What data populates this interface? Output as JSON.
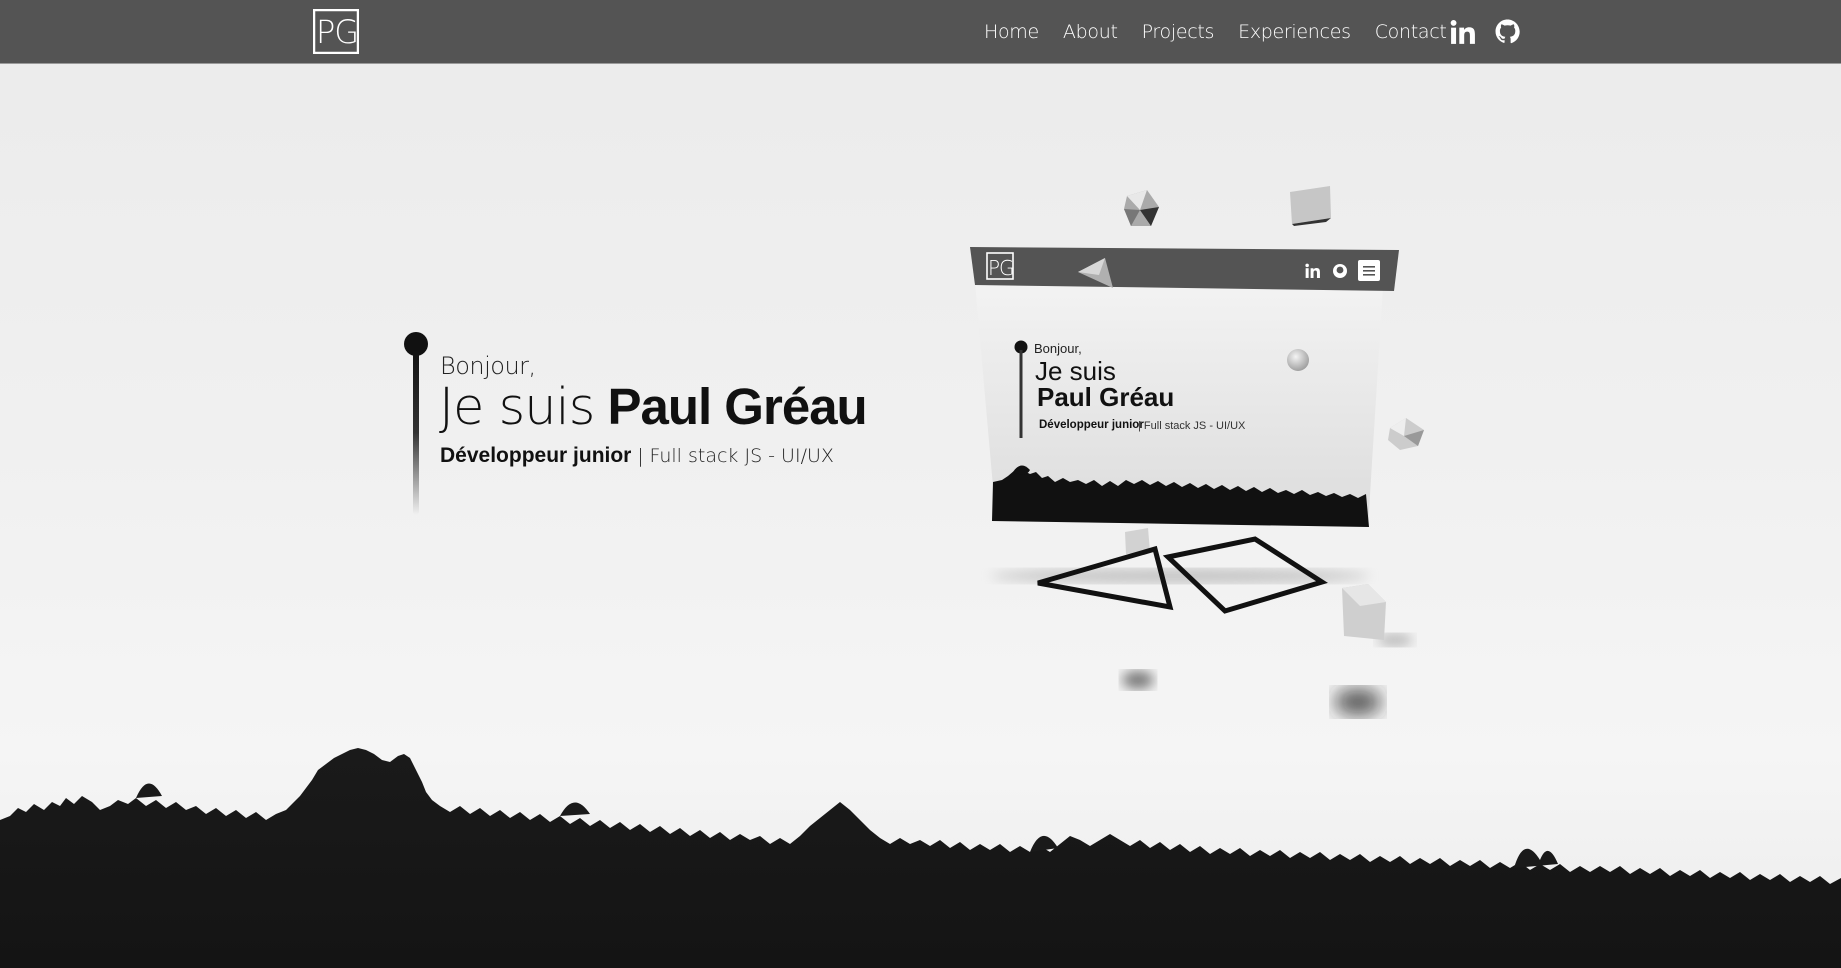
{
  "header": {
    "logo_text": "PG",
    "nav": [
      "Home",
      "About",
      "Projects",
      "Experiences",
      "Contact"
    ],
    "social": [
      {
        "name": "linkedin",
        "icon": "linkedin-icon"
      },
      {
        "name": "github",
        "icon": "github-icon"
      }
    ],
    "colors": {
      "bar": "#545454",
      "text": "#ffffff"
    }
  },
  "hero": {
    "greeting": "Bonjour,",
    "headline_prefix": "Je suis",
    "headline_name": "Paul Gréau",
    "role": "Développeur junior",
    "separator": "|",
    "stack": "Full stack JS - UI/UX"
  },
  "preview": {
    "logo_text": "PG",
    "greeting": "Bonjour,",
    "headline_prefix": "Je suis",
    "headline_name": "Paul Gréau",
    "role": "Développeur junior",
    "stack": "| Full stack JS - UI/UX",
    "menu_icon": "hamburger-icon"
  }
}
